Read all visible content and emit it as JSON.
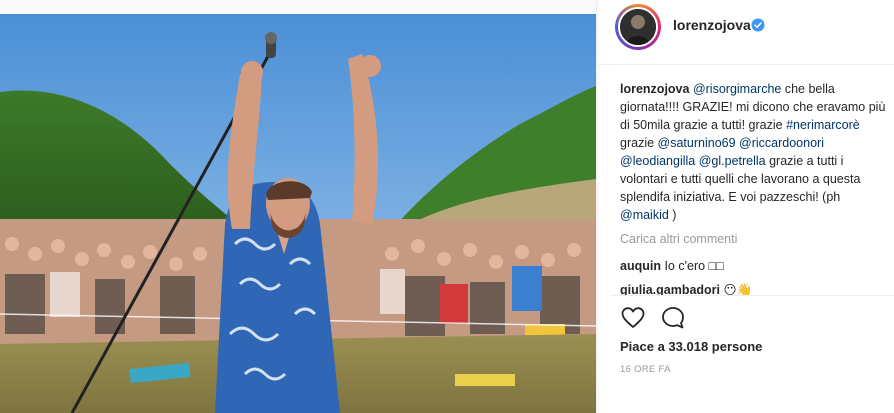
{
  "post": {
    "username": "lorenzojova",
    "verified_icon": "verified-badge-icon",
    "caption": {
      "username": "lorenzojova",
      "mention1": "@risorgimarche",
      "text1": " che bella giornata!!!! GRAZIE! mi dicono che eravamo più di 50mila grazie a tutti! grazie ",
      "hashtag": "#nerimarcorè",
      "text2": " grazie ",
      "mention2": "@saturnino69",
      "space1": " ",
      "mention3": "@riccardoonori",
      "space2": " ",
      "mention4": "@leodiangilla",
      "space3": " ",
      "mention5": "@gl.petrella",
      "text3": " grazie a tutti i volontari e tutti quelli che lavorano a questa splendifa iniziativa. E voi pazzeschi! (ph ",
      "mention6": "@maikid",
      "text4": " )"
    },
    "load_more": "Carica altri commenti",
    "comments": [
      {
        "user": "auquin",
        "text": "Io c'ero □□"
      },
      {
        "user": "giulia.gambadori",
        "text": "😶👋"
      }
    ],
    "likes_text": "Piace a 33.018 persone",
    "time_ago": "16 ORE FA",
    "icons": {
      "like": "heart-icon",
      "comment": "speech-bubble-icon"
    },
    "colors": {
      "link": "#003569",
      "verified": "#3897f0",
      "muted": "#999999",
      "text": "#262626"
    }
  }
}
